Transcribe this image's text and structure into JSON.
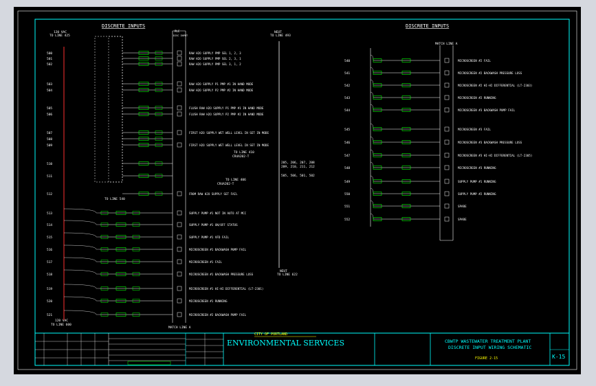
{
  "headers": {
    "left": "DISCRETE INPUTS",
    "right": "DISCRETE INPUTS"
  },
  "left_top_labels": {
    "supply": "120 VAC",
    "supply_from": "TO LINE 425",
    "neutral": "NEUT",
    "neutral_to": "TO LINE 493",
    "card_top": "PLC",
    "card_sub": "DISC INPUT"
  },
  "left_bottom_labels": {
    "supply": "120 VAC",
    "supply_to": "TO LINE 600",
    "neutral_to": "TO LINE 622",
    "neutral_tag": "NEUT",
    "match": "MATCH LINE A",
    "to_line_540": "TO LINE 540"
  },
  "left_rows": [
    {
      "line": "500",
      "text": "RAW H2O SUPPLY PMP SEL 1, 2, 3"
    },
    {
      "line": "501",
      "text": "RAW H2O SUPPLY PMP SEL 2, 3, 1"
    },
    {
      "line": "502",
      "text": "RAW H2O SUPPLY PMP SEL 3, 1, 2"
    },
    {
      "line": "503",
      "text": "RAW H2O SUPPLY P1 PMP #1 IN HAND MODE"
    },
    {
      "line": "504",
      "text": "RAW H2O SUPPLY P2 PMP #2 IN HAND MODE"
    },
    {
      "line": "505",
      "text": "FLUSH RAW H2O SUPPLY P1 PMP #1 IN HAND MODE"
    },
    {
      "line": "506",
      "text": "FLUSH RAW H2O SUPPLY P2 PMP #2 IN HAND MODE"
    },
    {
      "line": "507",
      "text": "FIRST H2O SUPPLY WET WELL LEVEL IN SET IN MODE"
    },
    {
      "line": "508",
      "text": ""
    },
    {
      "line": "509",
      "text": "FIRST H2O SUPPLY WET WELL LEVEL IN SET IN MODE"
    },
    {
      "line": "510",
      "text": ""
    },
    {
      "line": "511",
      "text": ""
    },
    {
      "line": "512",
      "text": "FROM RAW H2O SUPPLY SET FAIL"
    },
    {
      "line": "513",
      "text": "SUPPLY PUMP #1 NOT IN AUTO AT MCC"
    },
    {
      "line": "514",
      "text": "SUPPLY PUMP #1 ON/OFF STATUS"
    },
    {
      "line": "515",
      "text": "SUPPLY PUMP #1 VFD FAIL"
    },
    {
      "line": "516",
      "text": "MICROSCREEN #1 BACKWASH PUMP FAIL"
    },
    {
      "line": "517",
      "text": "MICROSCREEN #1 FAIL"
    },
    {
      "line": "518",
      "text": "MICROSCREEN #1 BACKWASH PRESSURE LOSS"
    },
    {
      "line": "519",
      "text": "MICROSCREEN #1 HI-HI DIFFERENTIAL (LT-2301)"
    },
    {
      "line": "520",
      "text": "MICROSCREEN #1 RUNNING"
    },
    {
      "line": "521",
      "text": "MICROSCREEN #2 BACKWASH PUMP FAIL"
    }
  ],
  "left_notes": [
    "TO LINE 410",
    "CR4A202-T",
    "TO LINE 406",
    "CR4A202-T",
    "205, 206, 207, 208",
    "209, 210, 211, 212",
    "505, 506, 501, 502"
  ],
  "right_rows": [
    {
      "line": "540",
      "text": "MICROSCREEN #2 FAIL"
    },
    {
      "line": "541",
      "text": "MICROSCREEN #2 BACKWASH PRESSURE LOSS"
    },
    {
      "line": "542",
      "text": "MICROSCREEN #2 HI-HI DIFFERENTIAL (LT-2303)"
    },
    {
      "line": "543",
      "text": "MICROSCREEN #2 RUNNING"
    },
    {
      "line": "544",
      "text": "MICROSCREEN #3 BACKWASH PUMP FAIL"
    },
    {
      "line": "545",
      "text": "MICROSCREEN #3 FAIL"
    },
    {
      "line": "546",
      "text": "MICROSCREEN #3 BACKWASH PRESSURE LOSS"
    },
    {
      "line": "547",
      "text": "MICROSCREEN #3 HI-HI DIFFERENTIAL (LT-2305)"
    },
    {
      "line": "548",
      "text": "MICROSCREEN #3 RUNNING"
    },
    {
      "line": "549",
      "text": "SUPPLY PUMP #1 RUNNING"
    },
    {
      "line": "550",
      "text": "SUPPLY PUMP #2 RUNNING"
    },
    {
      "line": "551",
      "text": "SPARE"
    },
    {
      "line": "552",
      "text": "SPARE"
    }
  ],
  "right_top_label": "MATCH LINE A",
  "title_block": {
    "city": "CITY OF PORTLAND",
    "dept": "ENVIRONMENTAL SERVICES",
    "title1": "CBWTP WASTEWATER TREATMENT PLANT",
    "title2": "DISCRETE INPUT WIRING SCHEMATIC",
    "figure": "FIGURE 2-15",
    "sheet": "K-15"
  },
  "colors": {
    "frame": "#00ffff",
    "text": "#ffffff",
    "wire": "#ffffff",
    "terminal": "#00ff00",
    "rail": "#ff3030",
    "dept": "#00ffff",
    "title": "#00ffff",
    "figure": "#ffff00"
  }
}
